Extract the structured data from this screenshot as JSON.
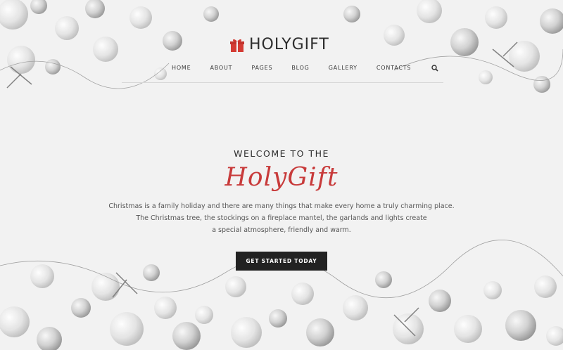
{
  "brand": {
    "name": "HOLYGIFT",
    "icon": "gift-icon",
    "accent": "#d43b34"
  },
  "nav": {
    "items": [
      "HOME",
      "ABOUT",
      "PAGES",
      "BLOG",
      "GALLERY",
      "CONTACTS"
    ],
    "search_icon": "search-icon"
  },
  "hero": {
    "kicker": "WELCOME TO THE",
    "title": "HolyGift",
    "description_lines": [
      "Christmas is a family holiday and there are many things that make every home a truly charming place.",
      "The Christmas tree, the stockings on a fireplace mantel, the garlands and lights create",
      "a special atmosphere, friendly and warm."
    ],
    "cta_label": "GET STARTED TODAY"
  },
  "colors": {
    "background": "#f2f2f2",
    "title_red": "#c83b3b",
    "button_bg": "#222222"
  }
}
